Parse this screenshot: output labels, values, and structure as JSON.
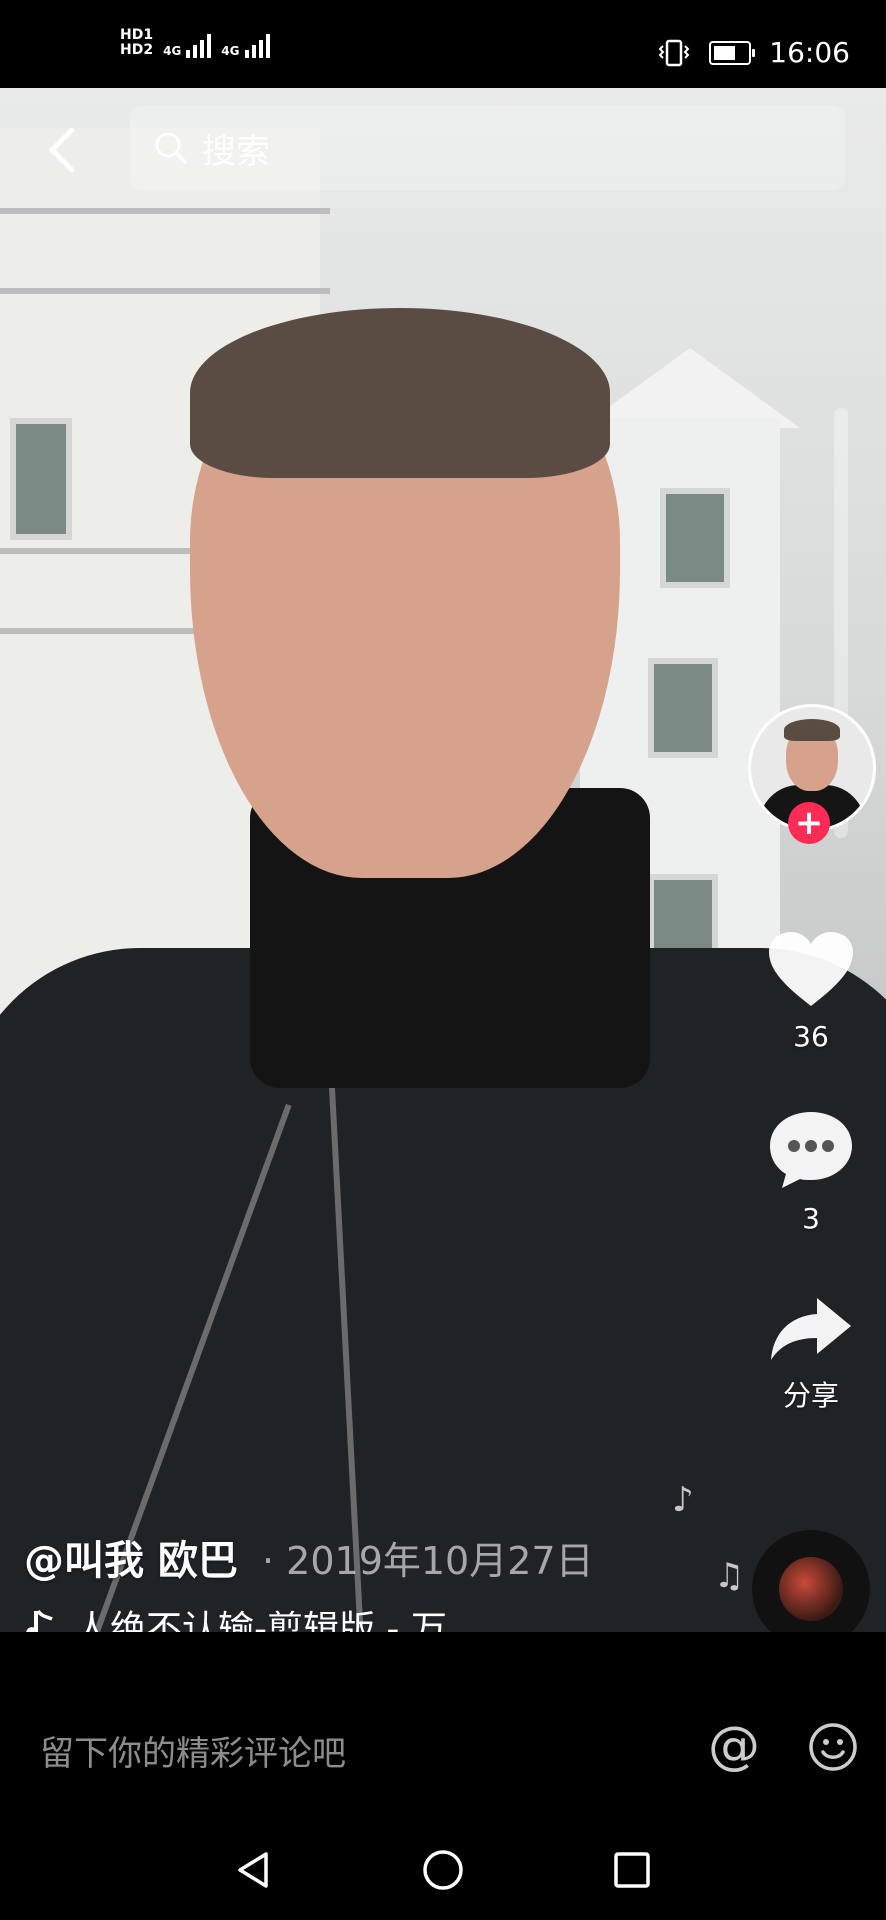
{
  "status_bar": {
    "hd1": "HD1",
    "hd2": "HD2",
    "net1": "4G",
    "net2": "4G",
    "time": "16:06"
  },
  "search": {
    "placeholder": "搜索"
  },
  "actions": {
    "like_count": "36",
    "comment_count": "3",
    "share_label": "分享"
  },
  "video_info": {
    "author": "@叫我  欧巴",
    "date": "· 2019年10月27日",
    "music": "人绝不认输-剪辑版 - 万"
  },
  "comment": {
    "placeholder": "留下你的精彩评论吧",
    "at_symbol": "@"
  },
  "colors": {
    "follow_accent": "#fe2c55",
    "background": "#000000"
  },
  "icons": [
    "back-icon",
    "search-icon",
    "heart-icon",
    "comment-icon",
    "share-icon",
    "music-note-icon",
    "emoji-icon",
    "nav-back-icon",
    "nav-home-icon",
    "nav-recents-icon"
  ]
}
